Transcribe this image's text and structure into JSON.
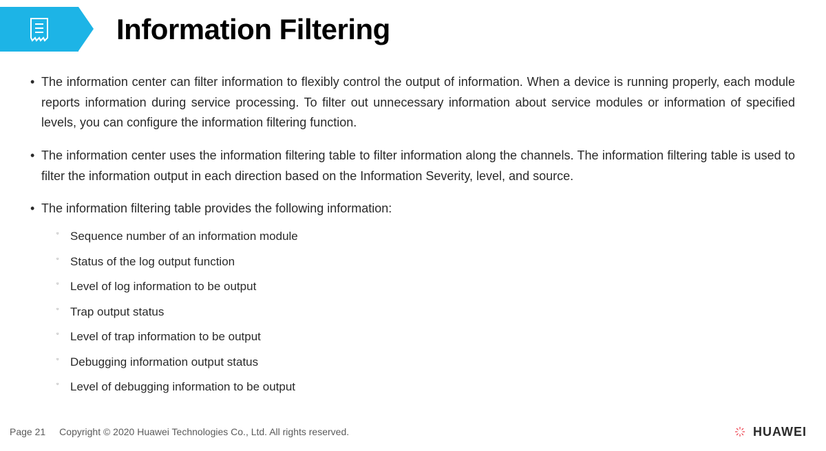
{
  "title": "Information Filtering",
  "bullets": [
    "The information center can filter information to flexibly control the output of information. When a device is running properly, each module reports information during service processing. To filter out unnecessary information about service modules or information of specified levels, you can configure the information filtering function.",
    "The information center uses the information filtering table to filter information along the channels. The information filtering table is used to filter the information output in each direction based on the Information Severity, level, and source.",
    "The information filtering table provides the following information:"
  ],
  "subitems": [
    "Sequence number of an information module",
    "Status of the log output function",
    "Level of log information to be output",
    "Trap output status",
    "Level of trap information to be output",
    "Debugging information output status",
    "Level of debugging information to be output"
  ],
  "footer": {
    "page": "Page 21",
    "copyright": "Copyright © 2020 Huawei Technologies Co., Ltd. All rights reserved.",
    "brand": "HUAWEI"
  }
}
